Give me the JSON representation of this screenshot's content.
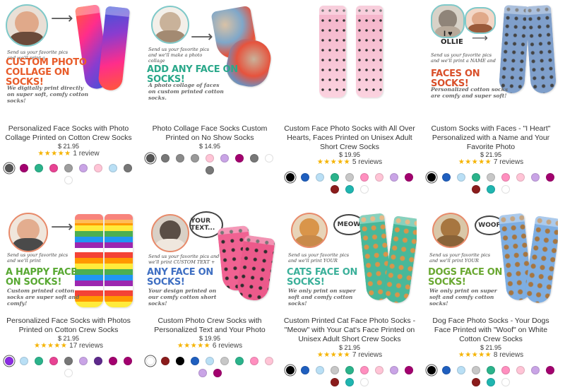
{
  "products": [
    {
      "title": "Personalized Face Socks with Photo Collage Printed on Cotton Crew Socks",
      "price": "$ 21.95",
      "stars": "★★★★★",
      "reviews": "1 review",
      "swatches": [
        "#555555",
        "#a3006f",
        "#2bb38b",
        "#e84393",
        "#9e9e9e",
        "#c9a4e6",
        "#ffc4d6",
        "#b9dff5",
        "#777777",
        "#ffffff"
      ],
      "selected_swatch": 0,
      "image": {
        "line1": "Send us your favorite pics and we'll print a",
        "headline": "CUSTOM PHOTO COLLAGE ON SOCKS!",
        "footnote": "We digitally print directly on super soft, comfy cotton socks!"
      }
    },
    {
      "title": "Photo Collage Face Socks Custom Printed on No Show Socks",
      "price": "$ 14.95",
      "stars": "",
      "reviews": "",
      "swatches": [
        "#555555",
        "#777777",
        "#8a8a8a",
        "#999999",
        "#ffc4d6",
        "#c9a4e6",
        "#a3006f",
        "#777777",
        "#ffffff",
        "#777777"
      ],
      "selected_swatch": 0,
      "image": {
        "line1": "Send us your favorite pics and we'll make a photo collage",
        "headline": "ADD ANY FACE ON SOCKS!",
        "footnote": "A photo collage of faces on custom printed cotton socks."
      }
    },
    {
      "title": "Custom Face Photo Socks with All Over Hearts, Faces Printed on Unisex Adult Short Crew Socks",
      "price": "$ 19.95",
      "stars": "★★★★★",
      "reviews": "5 reviews",
      "swatches": [
        "#000000",
        "#1f5fbf",
        "#b9dff5",
        "#2bb38b",
        "#c7c7c7",
        "#ff8fbf",
        "#ffc4d6",
        "#c9a4e6",
        "#a3006f",
        "#8b1c1c",
        "#1fb5b0",
        "#ffffff"
      ],
      "selected_swatch": 0,
      "image": {}
    },
    {
      "title": "Custom Socks with Faces - \"I Heart\" Personalized with a Name and Your Favorite Photo",
      "price": "$ 21.95",
      "stars": "★★★★★",
      "reviews": "7 reviews",
      "swatches": [
        "#000000",
        "#1f5fbf",
        "#b9dff5",
        "#2bb38b",
        "#c7c7c7",
        "#ff8fbf",
        "#ffc4d6",
        "#c9a4e6",
        "#a3006f",
        "#8b1c1c",
        "#1fb5b0",
        "#ffffff"
      ],
      "selected_swatch": 0,
      "image": {
        "name": "OLLIE",
        "line1": "Send us your favorite pics and we'll print a NAME and",
        "headline": "FACES ON SOCKS!",
        "footnote": "Personalized cotton socks are comfy and super soft!"
      }
    },
    {
      "title": "Personalized Face Socks with Photos Printed on Cotton Crew Socks",
      "price": "$ 21.95",
      "stars": "★★★★★",
      "reviews": "17 reviews",
      "swatches": [
        "#8b2be2",
        "#b9dff5",
        "#2bb38b",
        "#e84393",
        "#777777",
        "#c9a4e6",
        "#5e2a8c",
        "#a3006f",
        "#a3006f",
        "#ffffff"
      ],
      "selected_swatch": 0,
      "image": {
        "line1": "Send us your favorite pics and we'll print",
        "headline": "A HAPPY FACE ON SOCKS!",
        "footnote": "Custom printed cotton socks are super soft and comfy!"
      }
    },
    {
      "title": "Custom Photo Crew Socks with Personalized Text and Your Photo",
      "price": "$ 19.95",
      "stars": "★★★★★",
      "reviews": "6 reviews",
      "swatches": [
        "#ffffff",
        "#8b1c1c",
        "#000000",
        "#1f5fbf",
        "#b9dff5",
        "#c7c7c7",
        "#2bb38b",
        "#ff8fbf",
        "#ffc4d6",
        "#c9a4e6",
        "#a3006f"
      ],
      "selected_swatch": 0,
      "image": {
        "bubble": "YOUR TEXT...",
        "line1": "Send us your favorite pics and we'll print CUSTOM TEXT +",
        "headline": "ANY FACE ON SOCKS!",
        "footnote": "Your design printed on our comfy cotton short socks!"
      }
    },
    {
      "title": "Custom Printed Cat Face Photo Socks - \"Meow\" with Your Cat's Face Printed on Unisex Adult Short Crew Socks",
      "price": "$ 21.95",
      "stars": "★★★★★",
      "reviews": "7 reviews",
      "swatches": [
        "#000000",
        "#1f5fbf",
        "#b9dff5",
        "#c7c7c7",
        "#2bb38b",
        "#ff8fbf",
        "#ffc4d6",
        "#c9a4e6",
        "#a3006f",
        "#8b1c1c",
        "#1fb5b0",
        "#ffffff"
      ],
      "selected_swatch": 0,
      "image": {
        "bubble": "MEOW",
        "line1": "Send us your favorite pics and we'll print YOUR",
        "headline": "CATS FACE ON SOCKS!",
        "footnote": "We only print on super soft and comfy cotton socks!"
      }
    },
    {
      "title": "Dog Face Photo Socks - Your Dogs Face Printed with \"Woof\" on White Cotton Crew Socks",
      "price": "$ 21.95",
      "stars": "★★★★★",
      "reviews": "8 reviews",
      "swatches": [
        "#000000",
        "#1f5fbf",
        "#b9dff5",
        "#c7c7c7",
        "#2bb38b",
        "#ff8fbf",
        "#ffc4d6",
        "#c9a4e6",
        "#a3006f",
        "#8b1c1c",
        "#1fb5b0",
        "#ffffff"
      ],
      "selected_swatch": 0,
      "image": {
        "bubble": "WOOF",
        "line1": "Send us your favorite pics and we'll print YOUR",
        "headline": "DOGS FACE ON SOCKS!",
        "footnote": "We only print on super soft and comfy cotton socks!"
      }
    }
  ]
}
